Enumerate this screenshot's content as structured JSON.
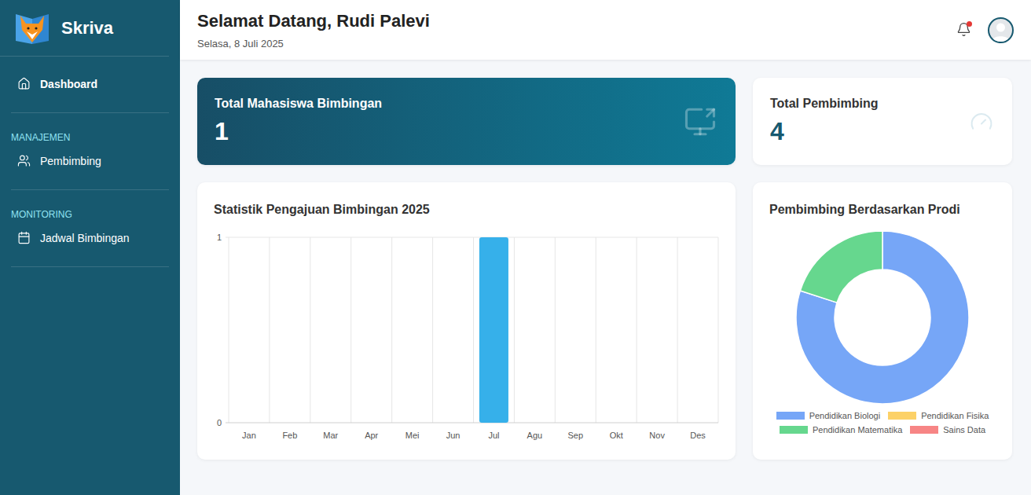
{
  "app": {
    "name": "Skriva"
  },
  "sidebar": {
    "sections": [
      {
        "items": [
          {
            "label": "Dashboard",
            "selected": true
          }
        ]
      },
      {
        "heading": "MANAJEMEN",
        "items": [
          {
            "label": "Pembimbing",
            "selected": false
          }
        ]
      },
      {
        "heading": "MONITORING",
        "items": [
          {
            "label": "Jadwal Bimbingan",
            "selected": false
          }
        ]
      }
    ]
  },
  "header": {
    "title": "Selamat Datang, Rudi Palevi",
    "date": "Selasa, 8 Juli 2025",
    "notifications": {
      "unread": true
    }
  },
  "stats": [
    {
      "label": "Total Mahasiswa Bimbingan",
      "value": "1",
      "kind": "highlight"
    },
    {
      "label": "Total Pembimbing",
      "value": "4",
      "kind": "plain"
    }
  ],
  "bar_chart": {
    "title": "Statistik Pengajuan Bimbingan 2025",
    "y_ticks": [
      "0",
      "1"
    ],
    "categories": [
      "Jan",
      "Feb",
      "Mar",
      "Apr",
      "Mei",
      "Jun",
      "Jul",
      "Agu",
      "Sep",
      "Okt",
      "Nov",
      "Des"
    ],
    "values": [
      0,
      0,
      0,
      0,
      0,
      0,
      1,
      0,
      0,
      0,
      0,
      0
    ]
  },
  "donut_chart": {
    "title": "Pembimbing Berdasarkan Prodi",
    "slices": [
      {
        "label": "Pendidikan Biologi",
        "value": 4,
        "color": "#76a6f7"
      },
      {
        "label": "Pendidikan Fisika",
        "value": 0,
        "color": "#fcd167"
      },
      {
        "label": "Pendidikan Matematika",
        "value": 1,
        "color": "#66d78e"
      },
      {
        "label": "Sains Data",
        "value": 0,
        "color": "#f78585"
      }
    ]
  }
}
